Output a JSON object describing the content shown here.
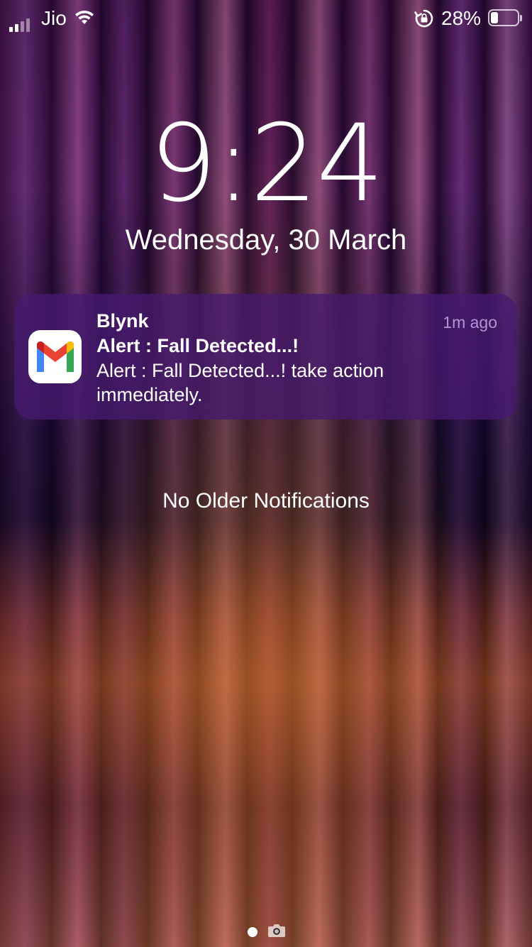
{
  "status_bar": {
    "carrier": "Jio",
    "battery_percent_label": "28%",
    "battery_level": 0.28,
    "signal_bars": 2,
    "signal_bars_max": 4,
    "icons": [
      "cellular-signal-icon",
      "wifi-icon",
      "rotation-lock-icon",
      "battery-icon"
    ]
  },
  "lock_screen": {
    "time": "9:24",
    "date": "Wednesday, 30 March"
  },
  "notification": {
    "app_icon": "gmail-icon",
    "app_name": "Blynk",
    "time_ago": "1m ago",
    "title": "Alert : Fall Detected...!",
    "body": "Alert : Fall Detected...! take action immediately."
  },
  "no_older_label": "No Older Notifications",
  "bottom": {
    "icons": [
      "page-dot-icon",
      "camera-icon"
    ]
  },
  "colors": {
    "gmail_red": "#EA4335",
    "gmail_blue": "#4285F4",
    "gmail_green": "#34A853",
    "gmail_yellow": "#FBBC04",
    "notification_bg": "#46196E"
  }
}
